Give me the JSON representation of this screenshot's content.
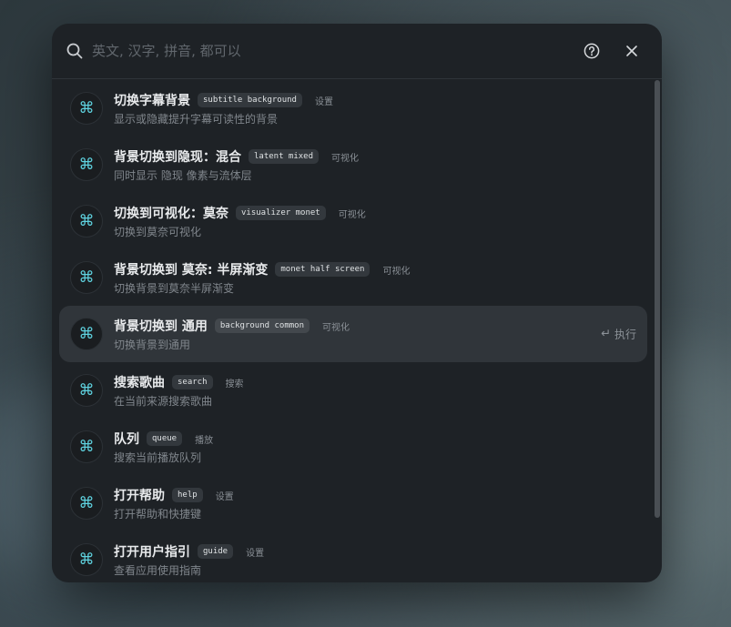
{
  "search": {
    "placeholder": "英文, 汉字, 拼音, 都可以"
  },
  "header": {
    "help_icon": "help-circle-icon",
    "close_icon": "close-icon"
  },
  "colors": {
    "accent": "#5fd3e0",
    "panel": "#1e2226",
    "active_row": "#30353a"
  },
  "commands": [
    {
      "title": "切换字幕背景",
      "tag": "subtitle background",
      "category": "设置",
      "desc": "显示或隐藏提升字幕可读性的背景"
    },
    {
      "title": "背景切换到隐现：混合",
      "tag": "latent mixed",
      "category": "可视化",
      "desc": "同时显示 隐现 像素与流体层"
    },
    {
      "title": "切换到可视化：莫奈",
      "tag": "visualizer monet",
      "category": "可视化",
      "desc": "切换到莫奈可视化"
    },
    {
      "title": "背景切换到 莫奈: 半屏渐变",
      "tag": "monet half screen",
      "category": "可视化",
      "desc": "切换背景到莫奈半屏渐变"
    },
    {
      "title": "背景切换到 通用",
      "tag": "background common",
      "category": "可视化",
      "desc": "切换背景到通用",
      "exec_label": "执行"
    },
    {
      "title": "搜索歌曲",
      "tag": "search",
      "category": "搜索",
      "desc": "在当前来源搜索歌曲"
    },
    {
      "title": "队列",
      "tag": "queue",
      "category": "播放",
      "desc": "搜索当前播放队列"
    },
    {
      "title": "打开帮助",
      "tag": "help",
      "category": "设置",
      "desc": "打开帮助和快捷键"
    },
    {
      "title": "打开用户指引",
      "tag": "guide",
      "category": "设置",
      "desc": "查看应用使用指南"
    }
  ],
  "item_icon": "command-key-icon",
  "active_index": 4
}
